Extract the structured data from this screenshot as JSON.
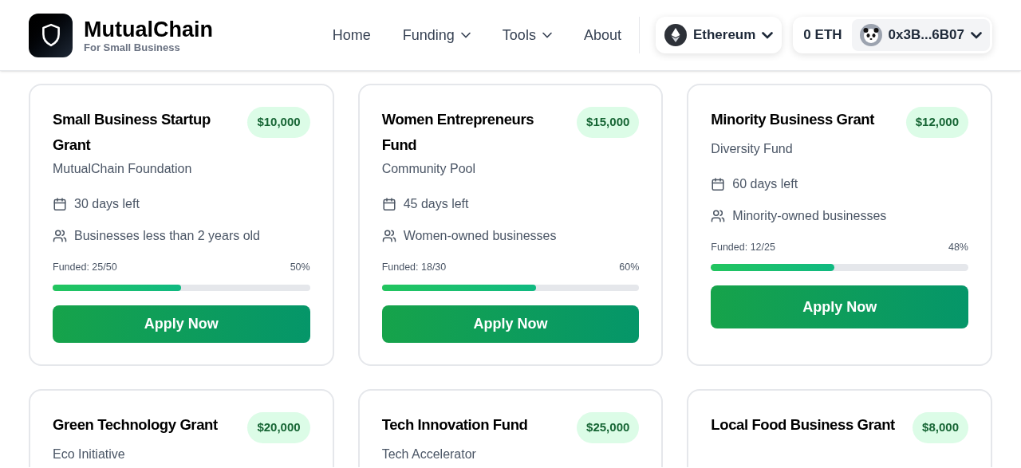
{
  "brand": {
    "name": "MutualChain",
    "tagline": "For Small Business"
  },
  "nav": [
    {
      "label": "Home",
      "dropdown": false
    },
    {
      "label": "Funding",
      "dropdown": true
    },
    {
      "label": "Tools",
      "dropdown": true
    },
    {
      "label": "About",
      "dropdown": false
    }
  ],
  "network": {
    "label": "Ethereum"
  },
  "wallet": {
    "balance": "0 ETH",
    "address": "0x3B...6B07"
  },
  "grants": [
    {
      "title": "Small Business Startup Grant",
      "amount": "$10,000",
      "sponsor": "MutualChain Foundation",
      "deadline": "30 days left",
      "eligibility": "Businesses less than 2 years old",
      "funded": "Funded: 25/50",
      "percent": "50%",
      "level": 0.5,
      "action": "Apply Now"
    },
    {
      "title": "Women Entrepreneurs Fund",
      "amount": "$15,000",
      "sponsor": "Community Pool",
      "deadline": "45 days left",
      "eligibility": "Women-owned businesses",
      "funded": "Funded: 18/30",
      "percent": "60%",
      "level": 0.6,
      "action": "Apply Now"
    },
    {
      "title": "Minority Business Grant",
      "amount": "$12,000",
      "sponsor": "Diversity Fund",
      "deadline": "60 days left",
      "eligibility": "Minority-owned businesses",
      "funded": "Funded: 12/25",
      "percent": "48%",
      "level": 0.48,
      "action": "Apply Now"
    },
    {
      "title": "Green Technology Grant",
      "amount": "$20,000",
      "sponsor": "Eco Initiative"
    },
    {
      "title": "Tech Innovation Fund",
      "amount": "$25,000",
      "sponsor": "Tech Accelerator"
    },
    {
      "title": "Local Food Business Grant",
      "amount": "$8,000"
    }
  ]
}
